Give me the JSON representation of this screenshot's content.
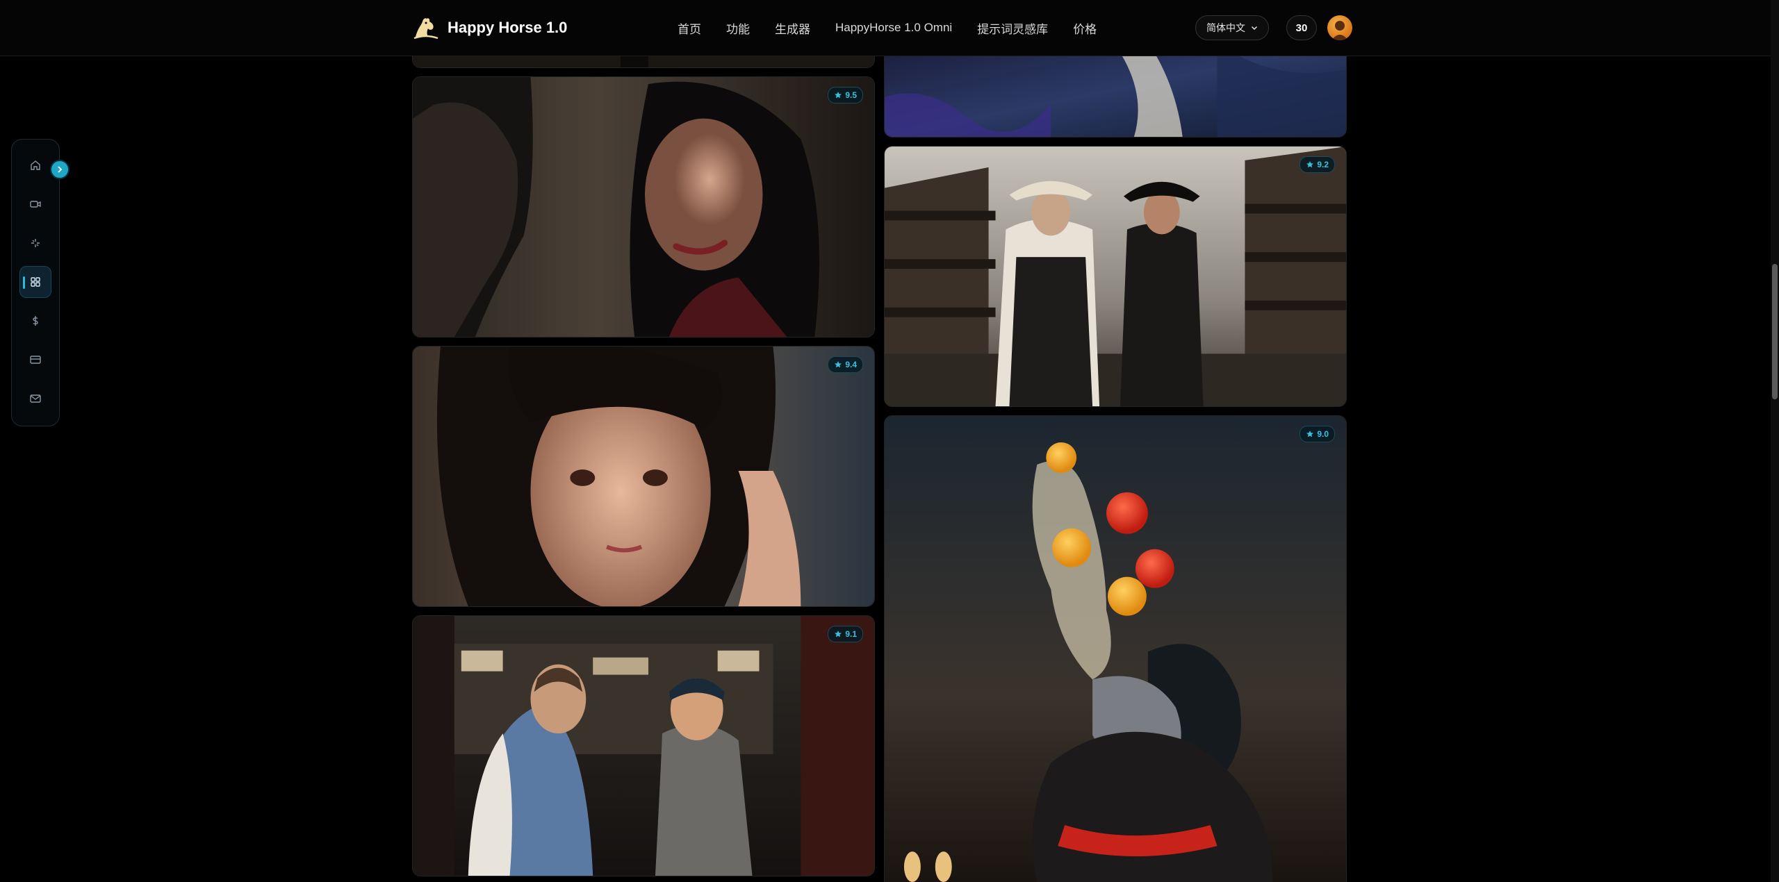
{
  "brand": {
    "name": "Happy Horse 1.0"
  },
  "nav": [
    {
      "label": "首页"
    },
    {
      "label": "功能"
    },
    {
      "label": "生成器"
    },
    {
      "label": "HappyHorse 1.0 Omni"
    },
    {
      "label": "提示词灵感库"
    },
    {
      "label": "价格"
    }
  ],
  "language": {
    "selected": "简体中文"
  },
  "credits": {
    "count": "30"
  },
  "sidebar": {
    "items": [
      {
        "icon": "home-icon"
      },
      {
        "icon": "video-icon"
      },
      {
        "icon": "sparkle-icon"
      },
      {
        "icon": "grid-icon",
        "active": true
      },
      {
        "icon": "dollar-icon"
      },
      {
        "icon": "card-icon"
      },
      {
        "icon": "mail-icon"
      }
    ],
    "toggle_icon": "chevron-right-icon"
  },
  "gallery": [
    {
      "rating": "9.5",
      "scene": "woman-cafe-dark-hair"
    },
    {
      "rating": "9.4",
      "scene": "woman-closeup-face"
    },
    {
      "rating": "9.1",
      "scene": "qing-dynasty-study"
    },
    {
      "rating": "9.2",
      "scene": "two-cowboys-corral"
    },
    {
      "rating": "9.0",
      "scene": "cat-chef-flipping-eggs"
    }
  ],
  "colors": {
    "accent": "#2fb8d6",
    "rating_text": "#37c3e0",
    "background": "#000000"
  }
}
